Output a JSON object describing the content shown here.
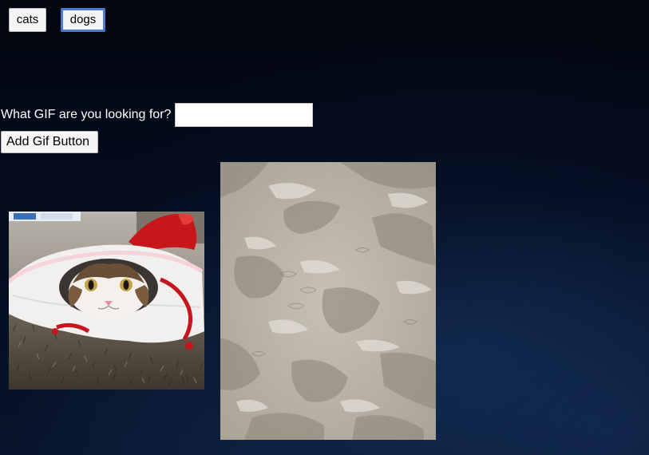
{
  "topics": {
    "cats_label": "cats",
    "dogs_label": "dogs"
  },
  "search": {
    "label": "What GIF are you looking for?",
    "value": "",
    "placeholder": ""
  },
  "add_button": {
    "label": "Add Gif Button"
  },
  "gifs": [
    {
      "subject": "cat-in-red-bag-gif"
    },
    {
      "subject": "sand-footprints-gif"
    }
  ]
}
